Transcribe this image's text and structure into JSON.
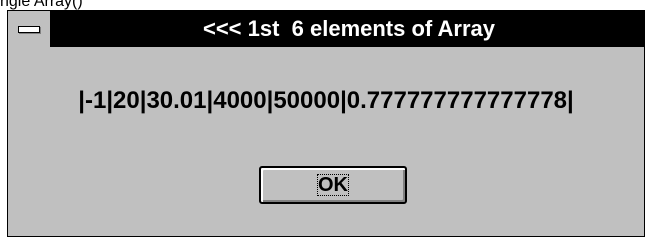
{
  "caption_above": "ngle Array()",
  "dialog": {
    "title": "<<< 1st  6 elements of Array",
    "message": "|-1|20|30.01|4000|50000|0.777777777777778|",
    "ok_label": "OK"
  },
  "icons": {
    "system_menu": "system-menu-icon"
  },
  "colors": {
    "title_bar": "#000000",
    "title_text": "#ffffff",
    "dialog_face": "#c0c0c0"
  }
}
